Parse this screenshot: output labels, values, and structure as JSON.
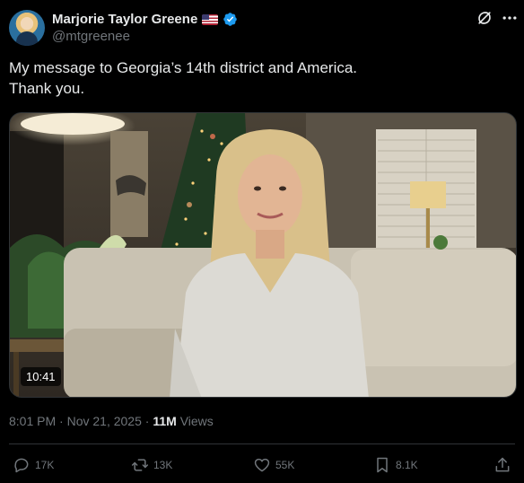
{
  "author": {
    "display_name": "Marjorie Taylor Greene",
    "handle": "@mtgreenee"
  },
  "tweet": {
    "text_line1": "My message to Georgia’s 14th district and America.",
    "text_line2": "Thank you."
  },
  "media": {
    "duration": "10:41"
  },
  "meta": {
    "time": "8:01 PM",
    "date": "Nov 21, 2025",
    "views_count": "11M",
    "views_label": "Views",
    "separator": "·"
  },
  "actions": {
    "replies": "17K",
    "reposts": "13K",
    "likes": "55K",
    "bookmarks": "8.1K"
  },
  "colors": {
    "background": "#000000",
    "text": "#e7e9ea",
    "secondary": "#71767b",
    "verified": "#1d9bf0"
  },
  "icons": [
    "verified-badge-icon",
    "us-flag-icon",
    "grok-icon",
    "more-icon",
    "reply-icon",
    "repost-icon",
    "like-icon",
    "bookmark-icon",
    "share-icon"
  ]
}
